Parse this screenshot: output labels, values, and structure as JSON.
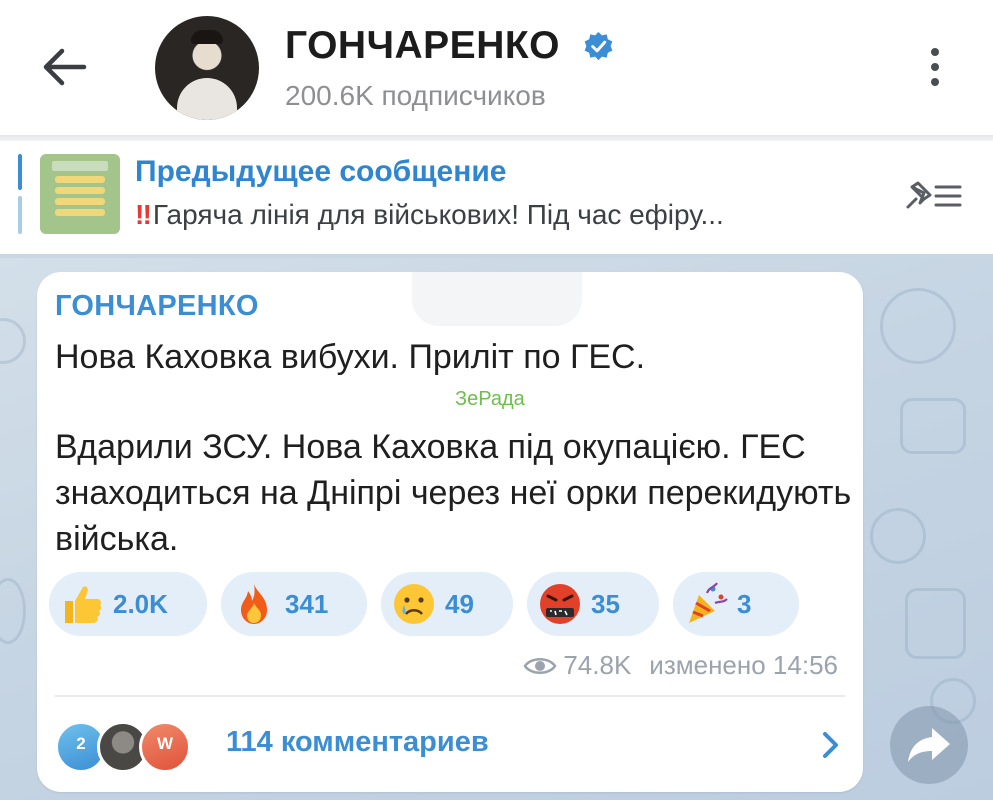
{
  "header": {
    "title": "ГОНЧАРЕНКО",
    "subscribers": "200.6K подписчиков"
  },
  "pinned": {
    "title": "Предыдущее сообщение",
    "excl": "‼",
    "text": "Гаряча лінія для військових!  Під час ефіру..."
  },
  "message": {
    "author": "ГОНЧАРЕНКО",
    "line1": "Нова Каховка вибухи. Приліт по ГЕС.",
    "watermark": "ЗеРада",
    "paragraph": "Вдарили ЗСУ. Нова Каховка під окупацією. ГЕС знаходиться на Дніпрі через неї орки перекидують війська.",
    "reactions": [
      {
        "emoji": "thumbs-up",
        "count": "2.0K"
      },
      {
        "emoji": "fire",
        "count": "341"
      },
      {
        "emoji": "crying-face",
        "count": "49"
      },
      {
        "emoji": "swearing-face",
        "count": "35"
      },
      {
        "emoji": "party-popper",
        "count": "3"
      }
    ],
    "views": "74.8K",
    "edited": "изменено 14:56",
    "comments": {
      "avatars": [
        "2",
        "",
        "W"
      ],
      "label": "114 комментариев"
    }
  },
  "colors": {
    "accent": "#3b8ed4",
    "reaction_bg": "#e3eef8",
    "wallpaper": "#c9d7e4",
    "watermark": "#6bbf4a"
  }
}
